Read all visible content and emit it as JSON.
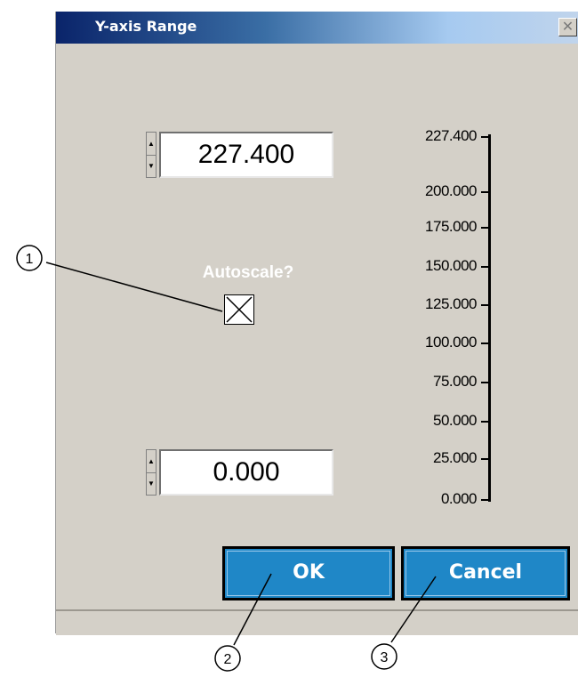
{
  "window": {
    "title": "Y-axis Range",
    "close_glyph": "✕"
  },
  "top_spinner": {
    "up_glyph": "▲",
    "down_glyph": "▼"
  },
  "max_field": {
    "value": "227.400"
  },
  "bottom_spinner": {
    "up_glyph": "▲",
    "down_glyph": "▼"
  },
  "min_field": {
    "value": "0.000"
  },
  "autoscale": {
    "label": "Autoscale?",
    "checked": true
  },
  "scale": {
    "ticks": [
      "227.400",
      "200.000",
      "175.000",
      "150.000",
      "125.000",
      "100.000",
      "75.000",
      "50.000",
      "25.000",
      "0.000"
    ]
  },
  "buttons": {
    "ok": "OK",
    "cancel": "Cancel"
  },
  "callouts": [
    "1",
    "2",
    "3"
  ],
  "colors": {
    "dialog_background": "#d4d0c8",
    "title_gradient_start": "#0a246a",
    "button_blue": "#1f87c7",
    "label_white": "#ffffff"
  }
}
